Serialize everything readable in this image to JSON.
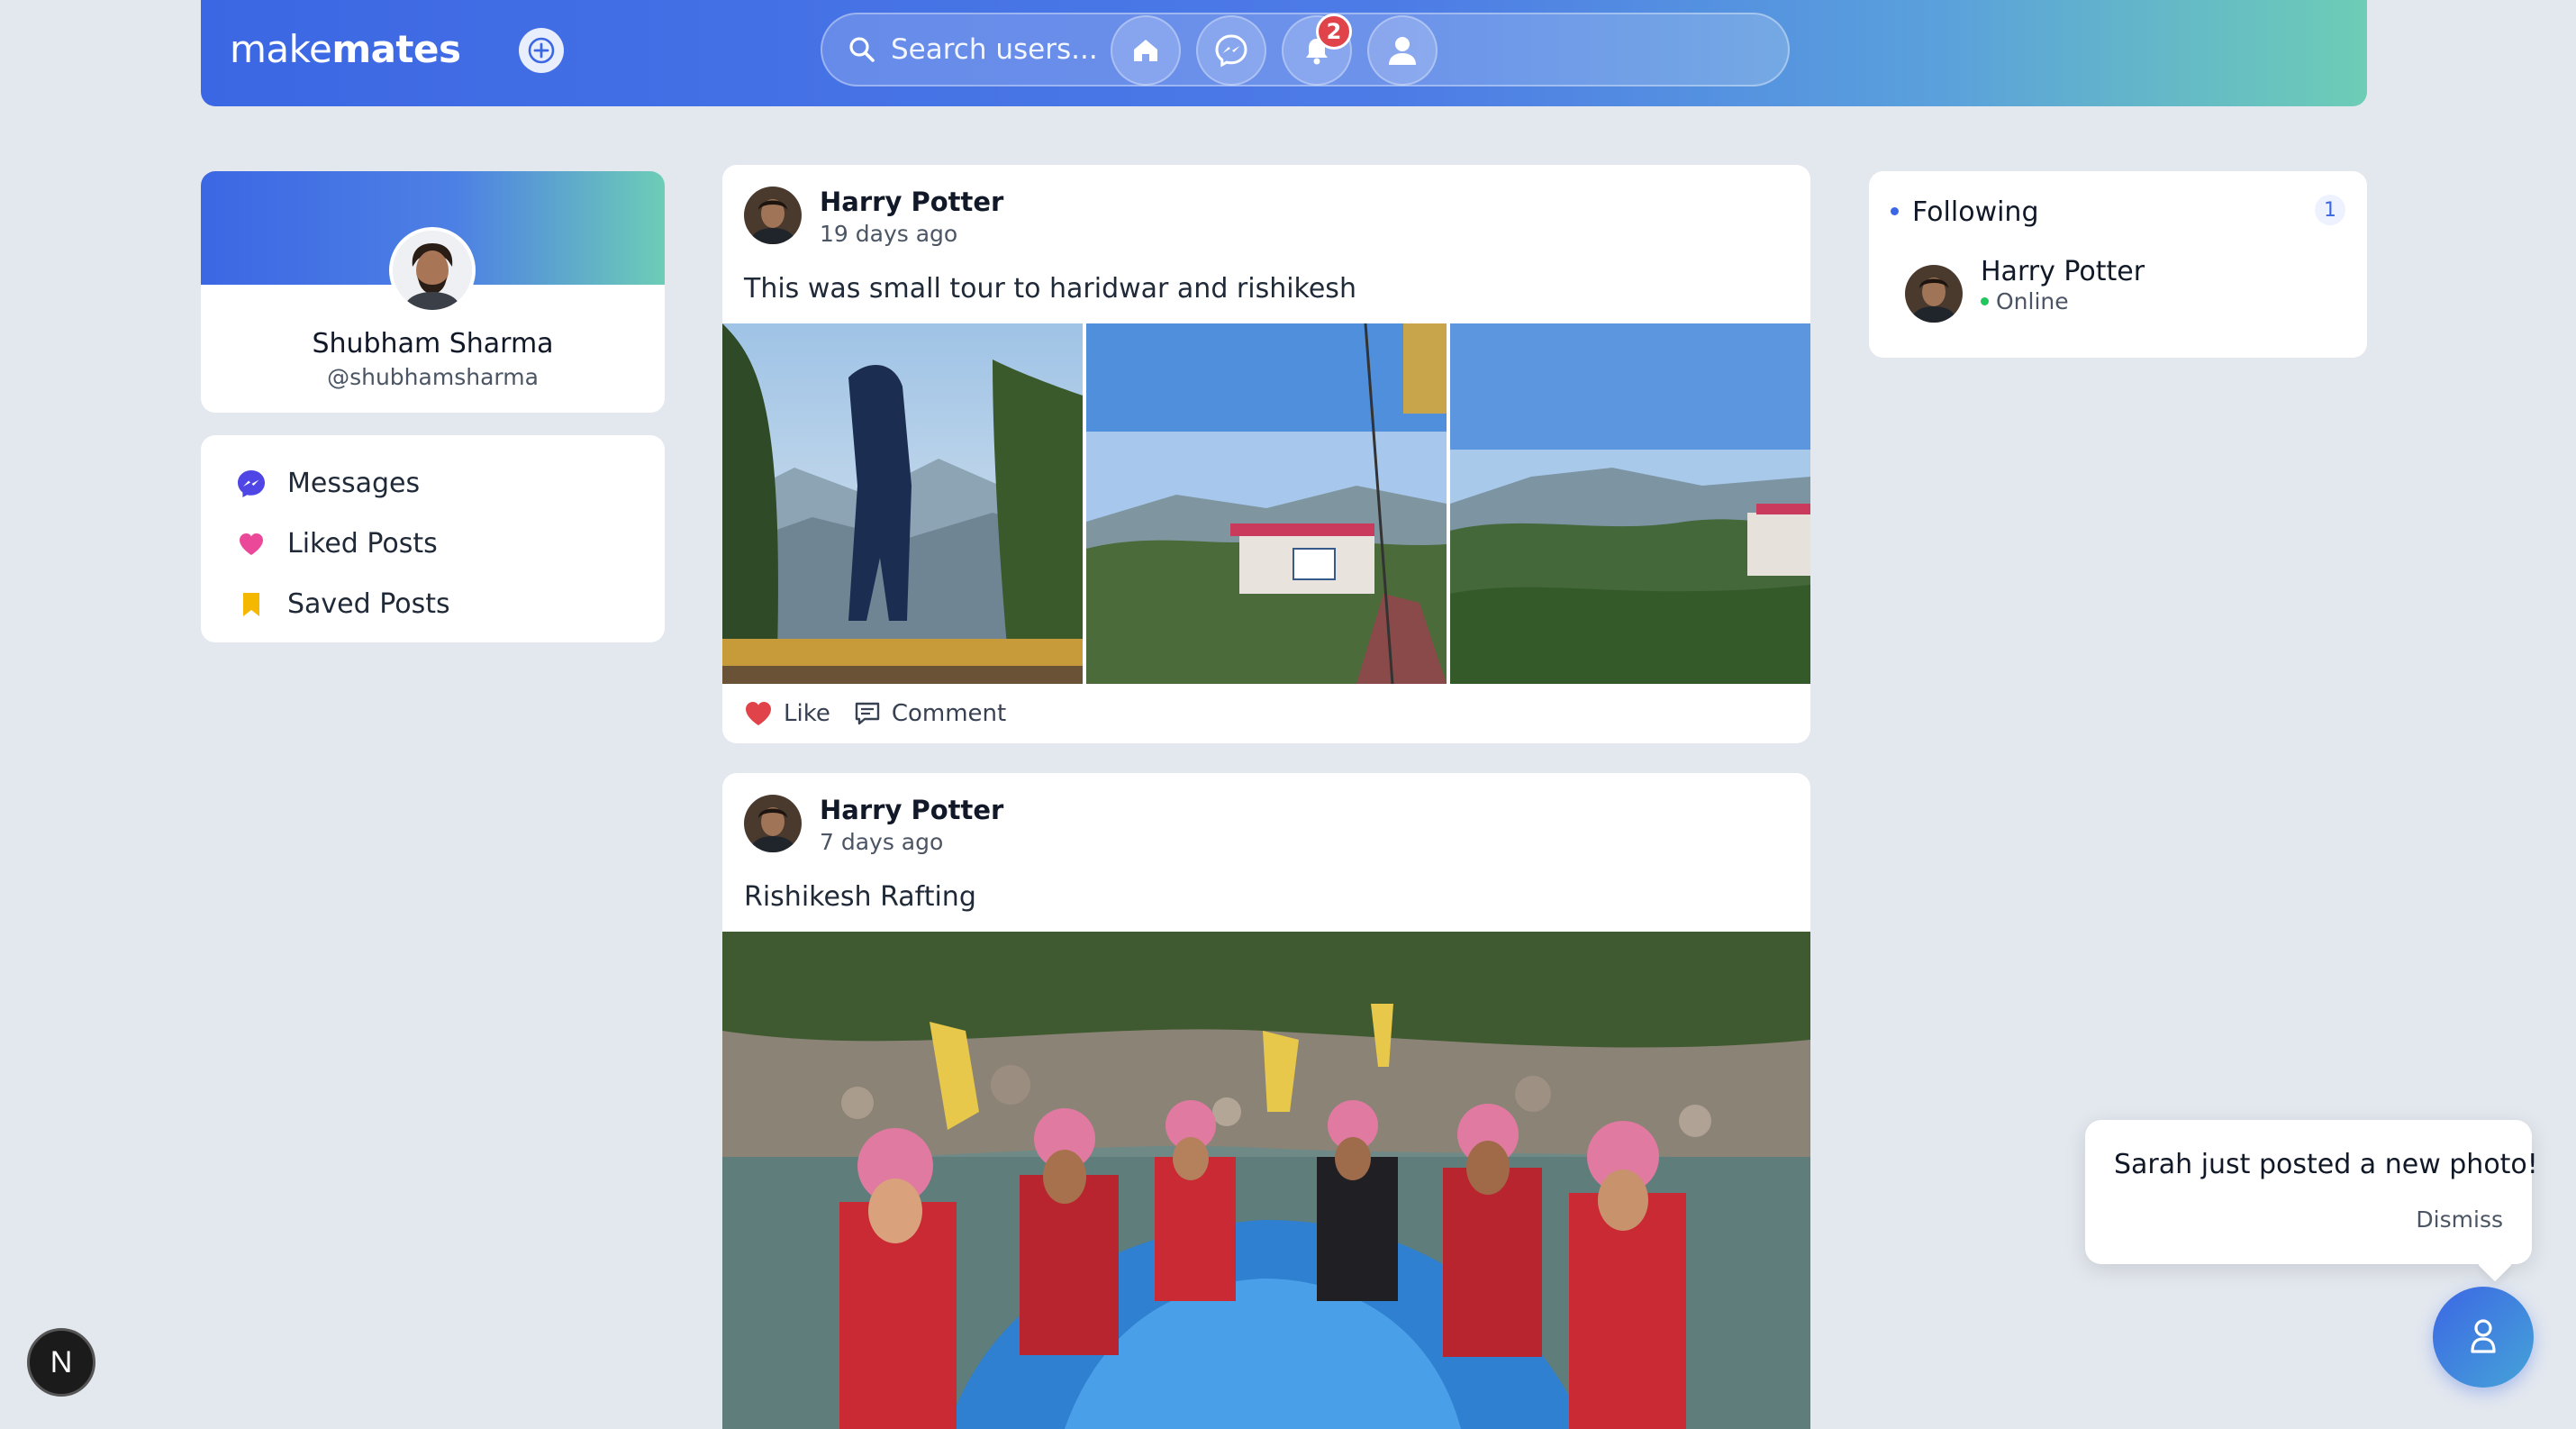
{
  "header": {
    "logo_light": "make",
    "logo_bold": "mates",
    "search_placeholder": "Search users...",
    "notification_count": "2",
    "icons": [
      "plus-icon",
      "search-icon",
      "home-icon",
      "messenger-icon",
      "bell-icon",
      "user-icon"
    ]
  },
  "profile": {
    "name": "Shubham Sharma",
    "handle": "@shubhamsharma"
  },
  "menu": [
    {
      "label": "Messages",
      "icon": "messenger-icon",
      "color": "#4f46e5"
    },
    {
      "label": "Liked Posts",
      "icon": "heart-icon",
      "color": "#ec4899"
    },
    {
      "label": "Saved Posts",
      "icon": "bookmark-icon",
      "color": "#f5b800"
    }
  ],
  "posts": [
    {
      "author": "Harry Potter",
      "time": "19 days ago",
      "text": "This was small tour to haridwar and rishikesh",
      "like_label": "Like",
      "comment_label": "Comment"
    },
    {
      "author": "Harry Potter",
      "time": "7 days ago",
      "text": "Rishikesh Rafting"
    }
  ],
  "following": {
    "title": "Following",
    "count": "1",
    "users": [
      {
        "name": "Harry Potter",
        "status": "Online"
      }
    ]
  },
  "notification": {
    "text": "Sarah just posted a new photo!",
    "dismiss_label": "Dismiss"
  },
  "dev_badge": "N",
  "colors": {
    "accent": "#3c67e4",
    "accent_end": "#6dcdb6",
    "background": "#e3e8ef",
    "like": "#e0434a",
    "online": "#22c55e"
  }
}
